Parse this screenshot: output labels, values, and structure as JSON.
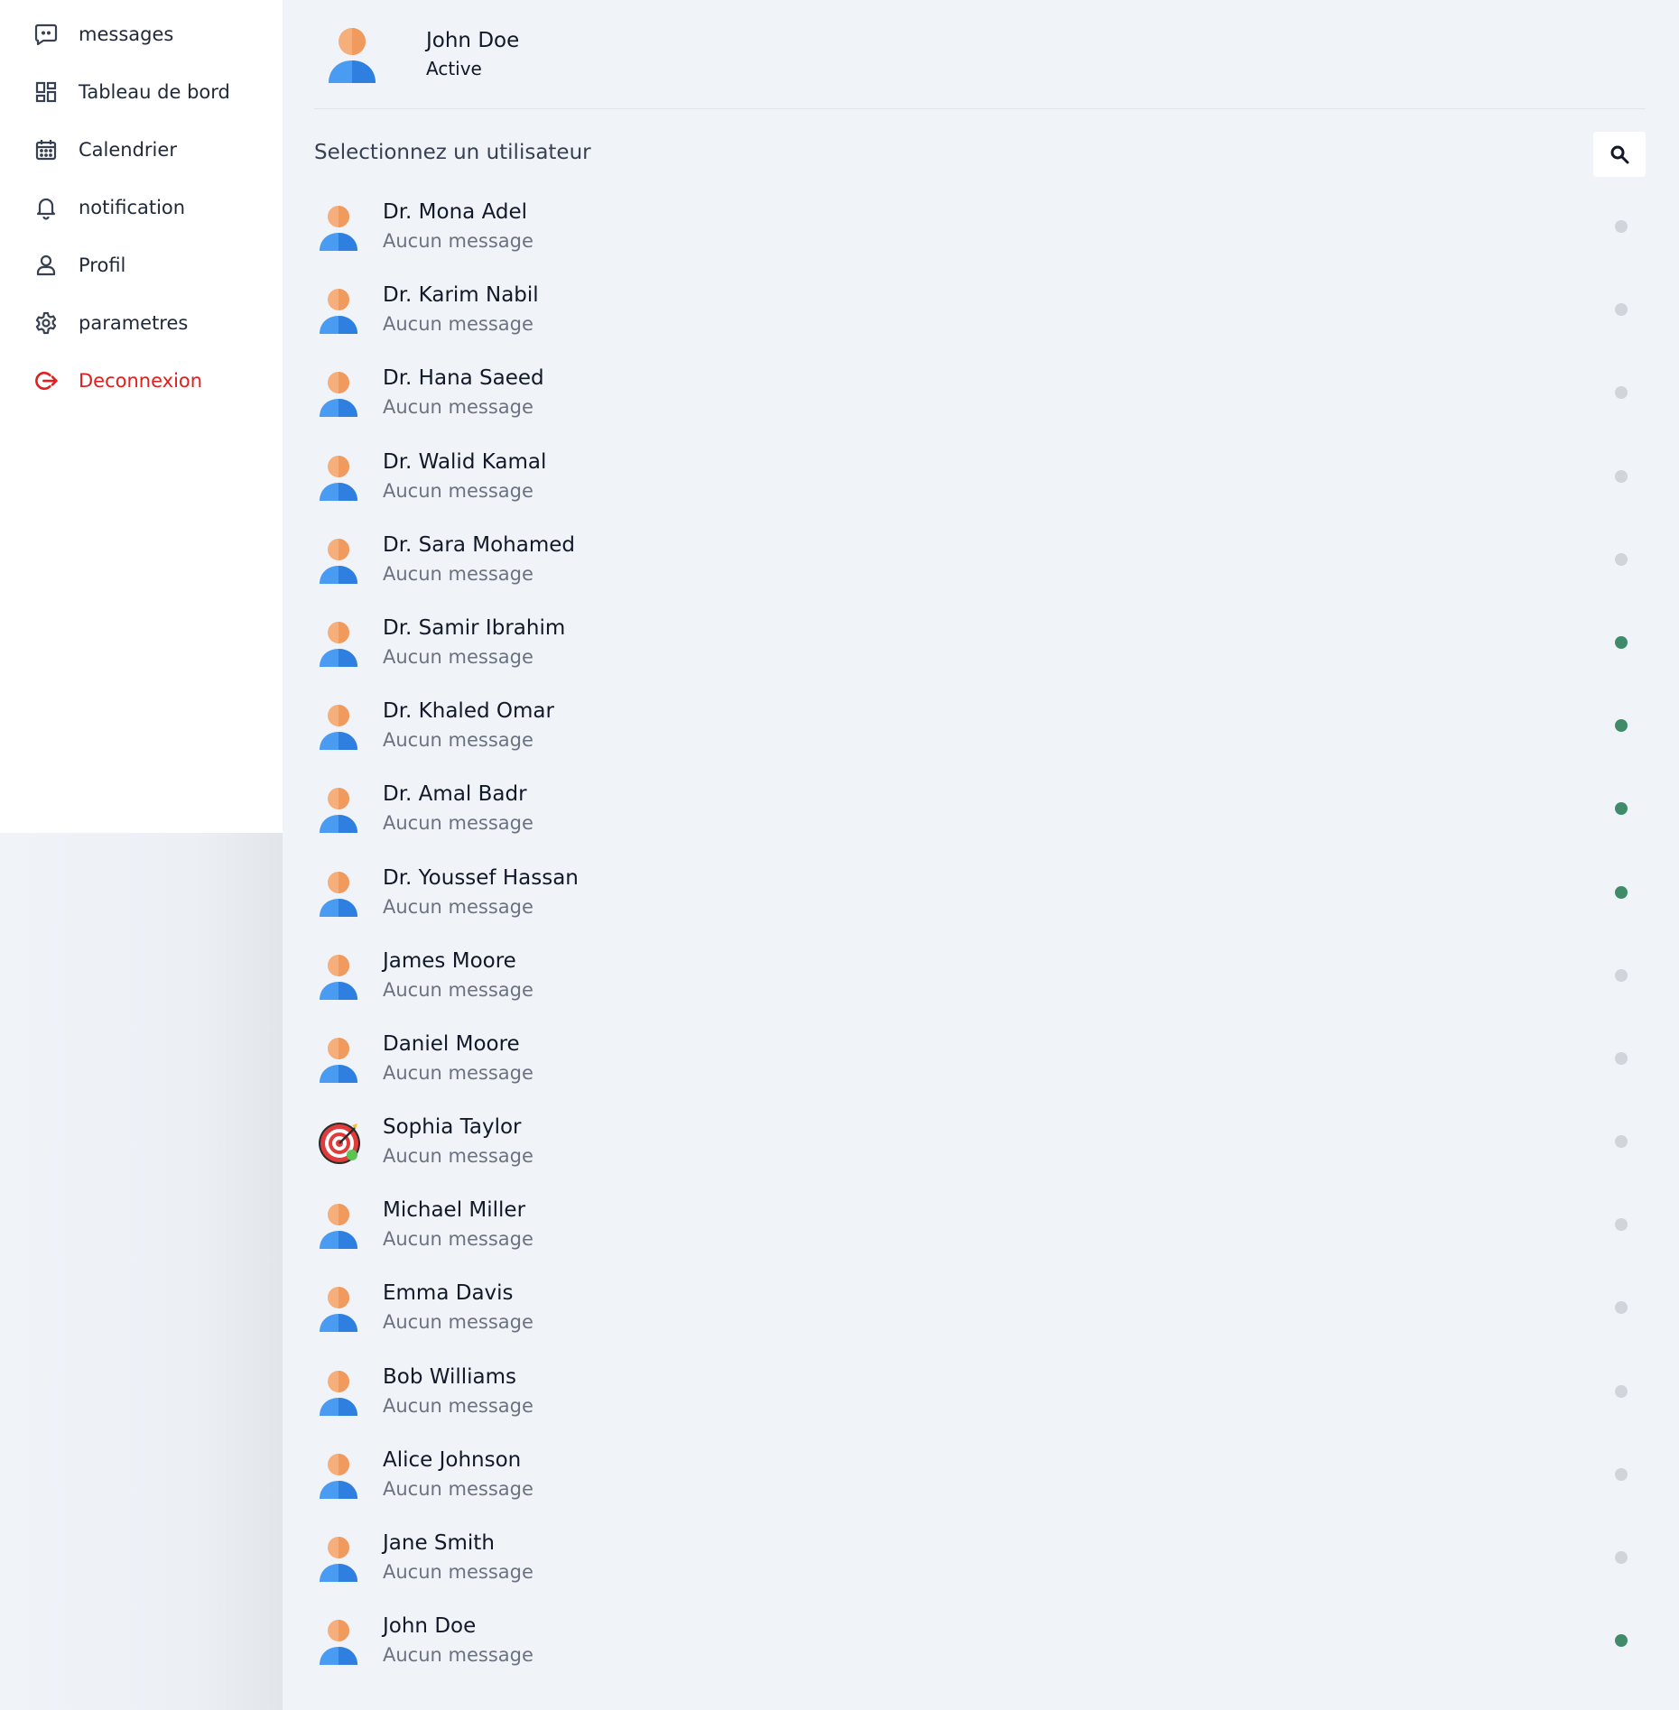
{
  "colors": {
    "online": "#3f8b6a",
    "offline": "#d1d5db",
    "logout": "#e11d1d",
    "avatar_head": "#f6ae7b",
    "avatar_body": "#3b8ff0"
  },
  "sidebar": {
    "items": [
      {
        "label": "messages",
        "icon": "chat-icon"
      },
      {
        "label": "Tableau de bord",
        "icon": "dashboard-icon"
      },
      {
        "label": "Calendrier",
        "icon": "calendar-icon"
      },
      {
        "label": "notification",
        "icon": "bell-icon"
      },
      {
        "label": "Profil",
        "icon": "user-icon"
      },
      {
        "label": "parametres",
        "icon": "gear-icon"
      },
      {
        "label": "Deconnexion",
        "icon": "logout-icon"
      }
    ]
  },
  "header": {
    "name": "John Doe",
    "status": "Active"
  },
  "search": {
    "placeholder": "Selectionnez un utilisateur",
    "icon": "search-icon"
  },
  "users": [
    {
      "name": "Dr. Mona Adel",
      "last_message": "Aucun message",
      "online": false,
      "avatar": "person-avatar"
    },
    {
      "name": "Dr. Karim Nabil",
      "last_message": "Aucun message",
      "online": false,
      "avatar": "person-avatar"
    },
    {
      "name": "Dr. Hana Saeed",
      "last_message": "Aucun message",
      "online": false,
      "avatar": "person-avatar"
    },
    {
      "name": "Dr. Walid Kamal",
      "last_message": "Aucun message",
      "online": false,
      "avatar": "person-avatar"
    },
    {
      "name": "Dr. Sara Mohamed",
      "last_message": "Aucun message",
      "online": false,
      "avatar": "person-avatar"
    },
    {
      "name": "Dr. Samir Ibrahim",
      "last_message": "Aucun message",
      "online": true,
      "avatar": "person-avatar"
    },
    {
      "name": "Dr. Khaled Omar",
      "last_message": "Aucun message",
      "online": true,
      "avatar": "person-avatar"
    },
    {
      "name": "Dr. Amal Badr",
      "last_message": "Aucun message",
      "online": true,
      "avatar": "person-avatar"
    },
    {
      "name": "Dr. Youssef Hassan",
      "last_message": "Aucun message",
      "online": true,
      "avatar": "person-avatar"
    },
    {
      "name": "James Moore",
      "last_message": "Aucun message",
      "online": false,
      "avatar": "person-avatar"
    },
    {
      "name": "Daniel Moore",
      "last_message": "Aucun message",
      "online": false,
      "avatar": "person-avatar"
    },
    {
      "name": "Sophia Taylor",
      "last_message": "Aucun message",
      "online": false,
      "avatar": "target-avatar"
    },
    {
      "name": "Michael Miller",
      "last_message": "Aucun message",
      "online": false,
      "avatar": "person-avatar"
    },
    {
      "name": "Emma Davis",
      "last_message": "Aucun message",
      "online": false,
      "avatar": "person-avatar"
    },
    {
      "name": "Bob Williams",
      "last_message": "Aucun message",
      "online": false,
      "avatar": "person-avatar"
    },
    {
      "name": "Alice Johnson",
      "last_message": "Aucun message",
      "online": false,
      "avatar": "person-avatar"
    },
    {
      "name": "Jane Smith",
      "last_message": "Aucun message",
      "online": false,
      "avatar": "person-avatar"
    },
    {
      "name": "John Doe",
      "last_message": "Aucun message",
      "online": true,
      "avatar": "person-avatar"
    }
  ]
}
